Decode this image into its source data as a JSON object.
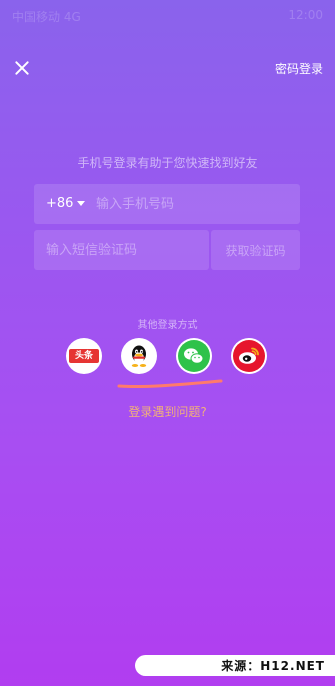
{
  "status_bar": {
    "left": "中国移动 4G",
    "right": "12:00"
  },
  "header": {
    "password_login_label": "密码登录"
  },
  "tip": "手机号登录有助于您快速找到好友",
  "phone": {
    "country_code": "+86",
    "placeholder": "输入手机号码"
  },
  "code": {
    "placeholder": "输入短信验证码",
    "get_code_label": "获取验证码"
  },
  "other_login": {
    "title": "其他登录方式",
    "providers": [
      {
        "label": "头条",
        "icon": "toutiao-icon",
        "color": "#e63533"
      },
      {
        "label": "",
        "icon": "qq-icon",
        "color": "#111111"
      },
      {
        "label": "",
        "icon": "wechat-icon",
        "color": "#2fc24a"
      },
      {
        "label": "",
        "icon": "weibo-icon",
        "color": "#e6162d"
      }
    ]
  },
  "trouble_label": "登录遇到问题?",
  "watermark": "来源：H12.NET",
  "colors": {
    "accent_link": "#f1b07a",
    "underline": "#ff7a6b"
  }
}
